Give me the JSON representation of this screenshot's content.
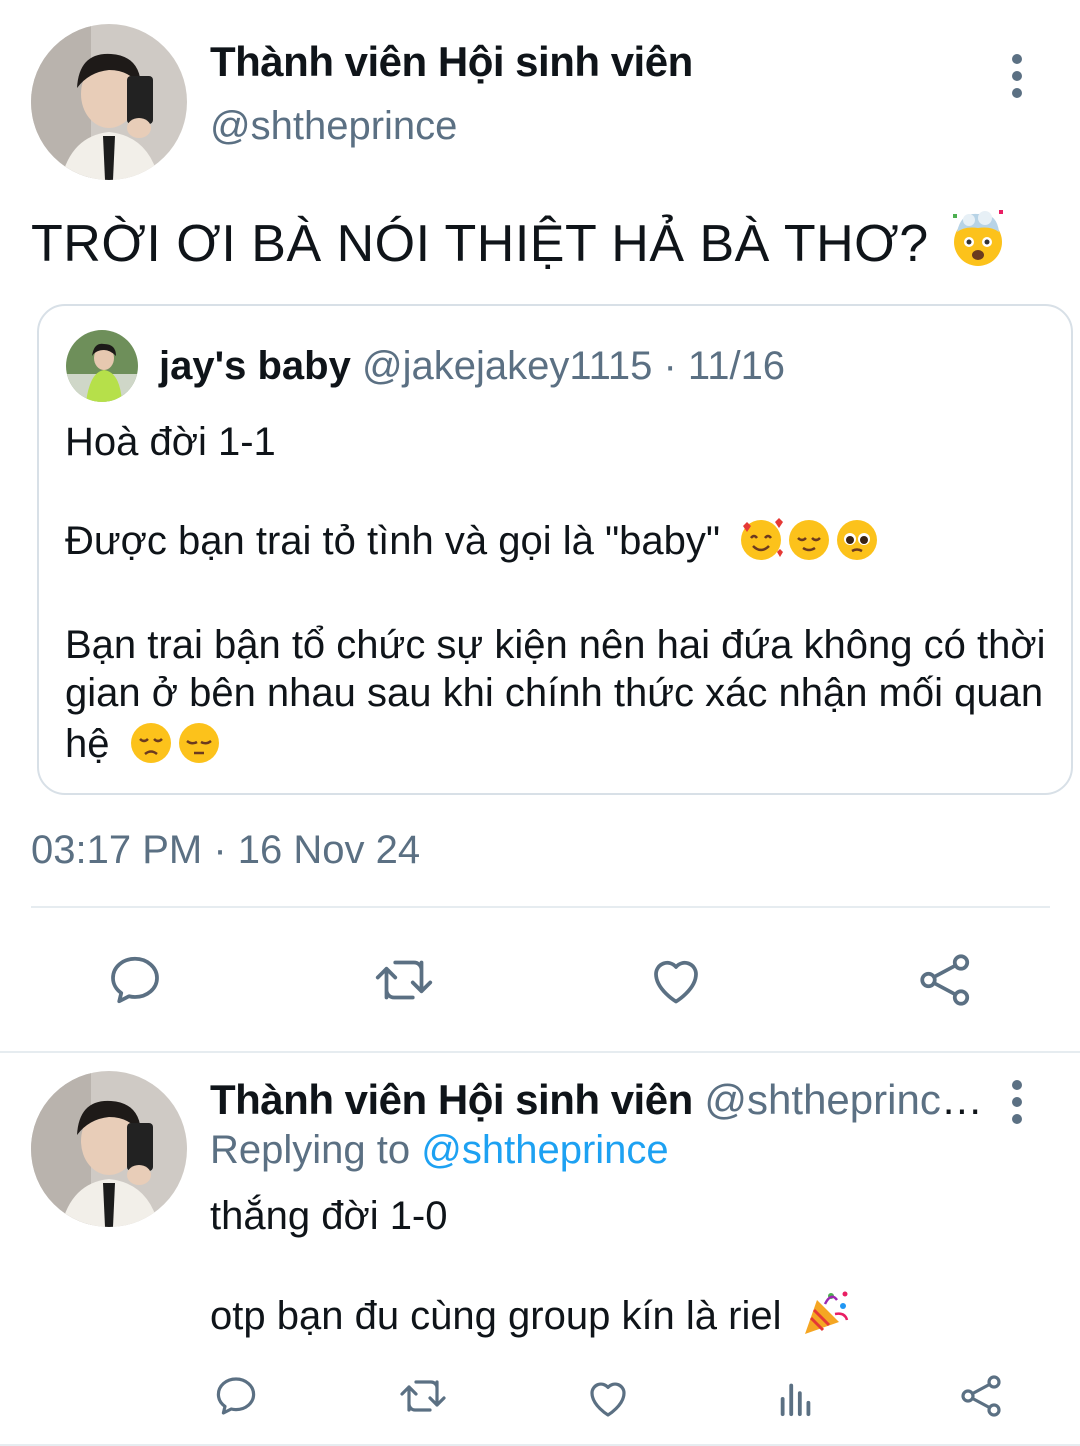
{
  "main_tweet": {
    "display_name": "Thành viên Hội sinh viên",
    "handle": "@shtheprince",
    "text": "TRỜI ƠI BÀ NÓI THIỆT HẢ BÀ THƠ?",
    "emoji_icon": "exploding-head-icon",
    "timestamp": "03:17 PM · 16 Nov 24"
  },
  "quoted_tweet": {
    "display_name": "jay's baby",
    "meta": "@jakejakey1115 · 11/16",
    "paragraphs": [
      "Hoà đời 1-1",
      "Được bạn trai tỏ tình và gọi là \"baby\"",
      "Bạn trai bận tổ chức sự kiện nên hai đứa không có thời gian ở bên nhau sau khi chính thức xác nhận mối quan hệ"
    ],
    "emoji_icons_p2": [
      "smiling-face-hearts-icon",
      "relieved-face-icon",
      "pleading-face-icon"
    ],
    "emoji_icons_p3": [
      "disappointed-face-icon",
      "pensive-face-icon"
    ]
  },
  "actions": [
    "reply-icon",
    "retweet-icon",
    "like-icon",
    "share-icon"
  ],
  "reply_tweet": {
    "display_name": "Thành viên Hội sinh viên",
    "handle_meta": "@shtheprince ·...",
    "replying_prefix": "Replying to",
    "replying_mention": "@shtheprince",
    "paragraphs": [
      "thắng đời 1-0",
      "otp bạn đu cùng group kín là riel"
    ],
    "emoji_icon": "party-popper-icon",
    "actions": [
      "reply-icon",
      "retweet-icon",
      "like-icon",
      "analytics-icon",
      "share-icon"
    ]
  },
  "colors": {
    "text": "#0f1419",
    "secondary": "#5b7083",
    "link": "#1da1f2",
    "border": "#d8e0e7"
  }
}
